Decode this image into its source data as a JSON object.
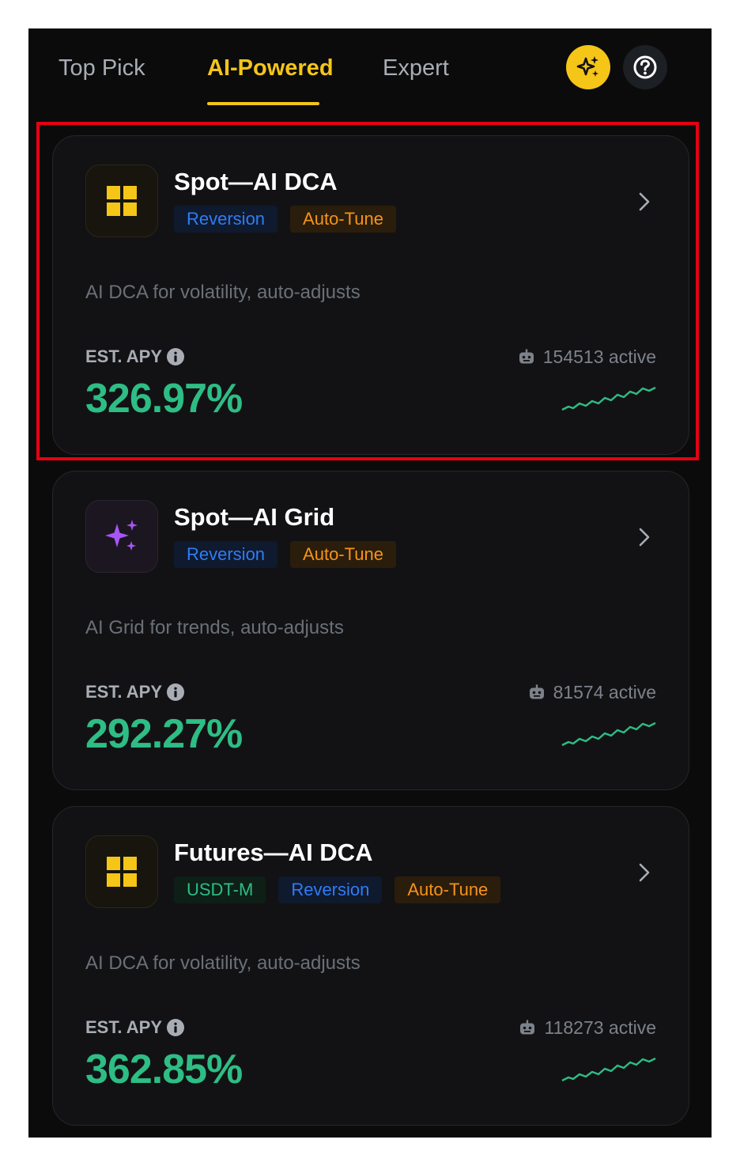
{
  "tabs": [
    {
      "label": "Top Pick",
      "active": false
    },
    {
      "label": "AI-Powered",
      "active": true
    },
    {
      "label": "Expert",
      "active": false
    }
  ],
  "header_icons": {
    "ai": "sparkle-icon",
    "help": "question-icon"
  },
  "colors": {
    "accent": "#f5c518",
    "positive": "#2ebd85",
    "tag_reversion": "#2f7cf6",
    "tag_autotune": "#f7931a",
    "highlight_border": "#e60012"
  },
  "cards": [
    {
      "title": "Spot—AI DCA",
      "icon": "grid-squares-icon",
      "tags": [
        "Reversion",
        "Auto-Tune"
      ],
      "description": "AI DCA for volatility, auto-adjusts",
      "apy_label": "EST. APY",
      "apy_value": "326.97%",
      "active_label": "154513 active",
      "highlighted": true
    },
    {
      "title": "Spot—AI Grid",
      "icon": "sparkle-icon",
      "tags": [
        "Reversion",
        "Auto-Tune"
      ],
      "description": "AI Grid for trends, auto-adjusts",
      "apy_label": "EST. APY",
      "apy_value": "292.27%",
      "active_label": "81574 active",
      "highlighted": false
    },
    {
      "title": "Futures—AI DCA",
      "icon": "grid-squares-icon",
      "tags": [
        "USDT-M",
        "Reversion",
        "Auto-Tune"
      ],
      "description": "AI DCA for volatility, auto-adjusts",
      "apy_label": "EST. APY",
      "apy_value": "362.85%",
      "active_label": "118273 active",
      "highlighted": false
    }
  ]
}
